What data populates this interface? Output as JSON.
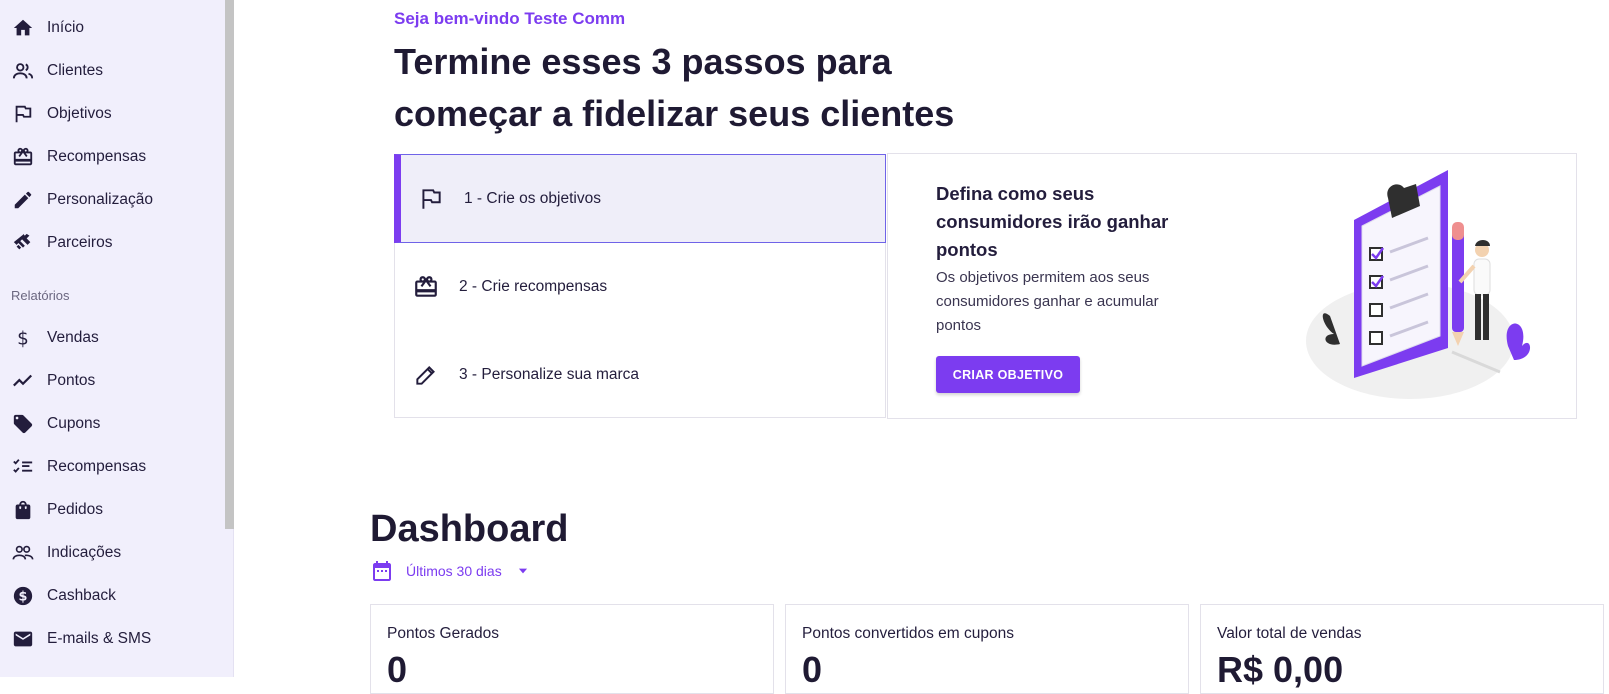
{
  "sidebar": {
    "items": [
      {
        "label": "Início",
        "icon": "home-icon"
      },
      {
        "label": "Clientes",
        "icon": "users-icon"
      },
      {
        "label": "Objetivos",
        "icon": "flag-icon"
      },
      {
        "label": "Recompensas",
        "icon": "gift-card-icon"
      },
      {
        "label": "Personalização",
        "icon": "pencil-icon"
      },
      {
        "label": "Parceiros",
        "icon": "handshake-icon"
      }
    ],
    "reports_label": "Relatórios",
    "report_items": [
      {
        "label": "Vendas",
        "icon": "dollar-icon"
      },
      {
        "label": "Pontos",
        "icon": "trending-icon"
      },
      {
        "label": "Cupons",
        "icon": "tag-icon"
      },
      {
        "label": "Recompensas",
        "icon": "checklist-icon"
      },
      {
        "label": "Pedidos",
        "icon": "shopping-bag-icon"
      },
      {
        "label": "Indicações",
        "icon": "group-icon"
      },
      {
        "label": "Cashback",
        "icon": "coin-dollar-icon"
      },
      {
        "label": "E-mails & SMS",
        "icon": "mail-icon"
      }
    ]
  },
  "onboarding": {
    "welcome": "Seja bem-vindo Teste Comm",
    "headline": "Termine esses 3 passos para começar a fidelizar seus clientes",
    "steps": [
      {
        "label": "1 - Crie os objetivos",
        "icon": "flag-icon"
      },
      {
        "label": "2 - Crie recompensas",
        "icon": "gift-card-icon"
      },
      {
        "label": "3 - Personalize sua marca",
        "icon": "pencil-icon"
      }
    ],
    "active_step": 1,
    "detail": {
      "title": "Defina como seus consumidores irão ganhar pontos",
      "description": "Os objetivos permitem aos seus consumidores ganhar e acumular pontos",
      "button": "CRIAR OBJETIVO"
    }
  },
  "dashboard": {
    "title": "Dashboard",
    "period": "Últimos 30 dias",
    "cards": [
      {
        "label": "Pontos Gerados",
        "value": "0"
      },
      {
        "label": "Pontos convertidos em cupons",
        "value": "0"
      },
      {
        "label": "Valor total de vendas",
        "value": "R$ 0,00"
      }
    ]
  },
  "colors": {
    "accent": "#7c3cf0",
    "sidebar_bg": "#f1effc",
    "text": "#231d3c"
  }
}
